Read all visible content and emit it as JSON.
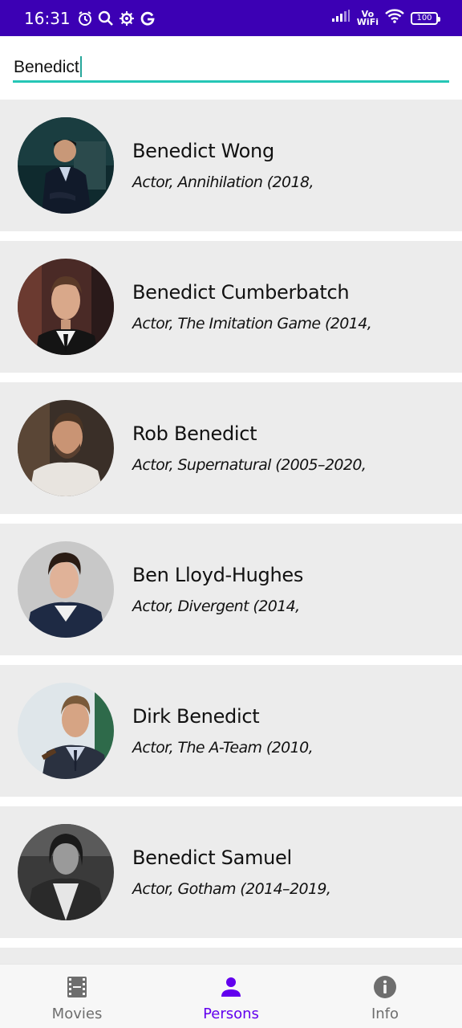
{
  "status_bar": {
    "time": "16:31",
    "network": "Vo\nWiFi",
    "battery": "100",
    "icons": [
      "alarm-icon",
      "search-icon",
      "settings-icon",
      "google-icon",
      "signal-icon",
      "wifi-icon",
      "battery-icon"
    ]
  },
  "search": {
    "value": "Benedict",
    "accent_color": "#26c6b6"
  },
  "persons": [
    {
      "name": "Benedict Wong",
      "role": "Actor, Annihilation (2018,",
      "avatar": "photo-benedict-wong"
    },
    {
      "name": "Benedict Cumberbatch",
      "role": "Actor, The Imitation Game (2014,",
      "avatar": "photo-benedict-cumberbatch"
    },
    {
      "name": "Rob Benedict",
      "role": "Actor, Supernatural (2005–2020,",
      "avatar": "photo-rob-benedict"
    },
    {
      "name": "Ben Lloyd-Hughes",
      "role": "Actor, Divergent (2014,",
      "avatar": "photo-ben-lloyd-hughes"
    },
    {
      "name": "Dirk Benedict",
      "role": "Actor, The A-Team (2010,",
      "avatar": "photo-dirk-benedict"
    },
    {
      "name": "Benedict Samuel",
      "role": "Actor, Gotham (2014–2019,",
      "avatar": "photo-benedict-samuel"
    }
  ],
  "bottom_nav": {
    "items": [
      {
        "label": "Movies",
        "icon": "film-icon",
        "active": false
      },
      {
        "label": "Persons",
        "icon": "person-icon",
        "active": true
      },
      {
        "label": "Info",
        "icon": "info-icon",
        "active": false
      }
    ],
    "active_color": "#6200ee",
    "inactive_color": "#6e6e6e"
  },
  "colors": {
    "status_bar": "#3c00b4",
    "card_background": "#ececec"
  }
}
